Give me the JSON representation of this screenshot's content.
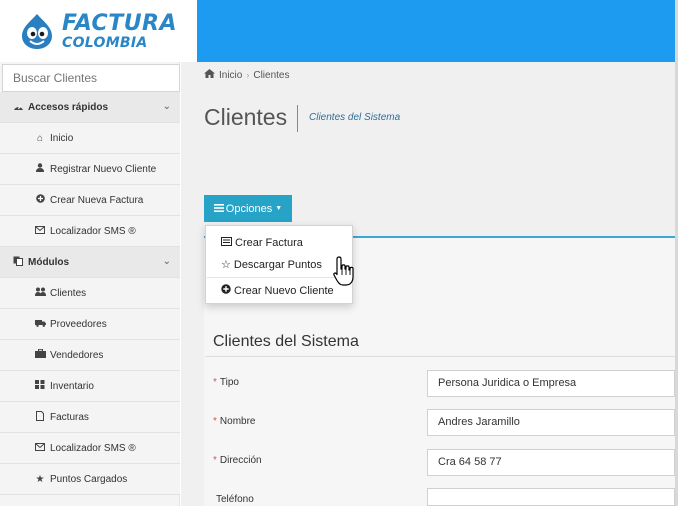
{
  "logo": {
    "line1": "FACTURA",
    "line2": "COLOMBIA"
  },
  "search": {
    "placeholder": "Buscar Clientes"
  },
  "sidebar": {
    "accesos": {
      "label": "Accesos rápidos",
      "items": [
        {
          "label": "Inicio",
          "icon": "home-icon"
        },
        {
          "label": "Registrar Nuevo Cliente",
          "icon": "user-icon"
        },
        {
          "label": "Crear Nueva Factura",
          "icon": "plus-circle-icon"
        },
        {
          "label": "Localizador SMS ®",
          "icon": "envelope-icon"
        }
      ]
    },
    "modulos": {
      "label": "Módulos",
      "items": [
        {
          "label": "Clientes",
          "icon": "users-icon"
        },
        {
          "label": "Proveedores",
          "icon": "truck-icon"
        },
        {
          "label": "Vendedores",
          "icon": "briefcase-icon"
        },
        {
          "label": "Inventario",
          "icon": "grid-icon"
        },
        {
          "label": "Facturas",
          "icon": "file-icon"
        },
        {
          "label": "Localizador SMS ®",
          "icon": "envelope-icon"
        },
        {
          "label": "Puntos Cargados",
          "icon": "star-icon"
        }
      ]
    }
  },
  "breadcrumb": {
    "home": "Inicio",
    "current": "Clientes"
  },
  "page": {
    "title": "Clientes",
    "subtitle": "Clientes del Sistema"
  },
  "options_button": {
    "label": "Opciones"
  },
  "dropdown": {
    "items": [
      {
        "label": "Crear Factura",
        "icon": "list-icon"
      },
      {
        "label": "Descargar Puntos",
        "icon": "star-outline-icon"
      },
      {
        "label": "Crear Nuevo Cliente",
        "icon": "plus-circle-icon"
      }
    ]
  },
  "panel": {
    "title": "Clientes del Sistema",
    "fields": [
      {
        "label": "Tipo",
        "required": "*",
        "value": "Persona Juridica o Empresa"
      },
      {
        "label": "Nombre",
        "required": "*",
        "value": "Andres Jaramillo"
      },
      {
        "label": "Dirección",
        "required": "*",
        "value": "Cra 64 58 77"
      },
      {
        "label": "Teléfono",
        "required": "",
        "value": ""
      }
    ]
  },
  "colors": {
    "topbar": "#1d9bf0",
    "button": "#27a3c8",
    "accent": "#38a9d3",
    "required": "#d9534f"
  }
}
